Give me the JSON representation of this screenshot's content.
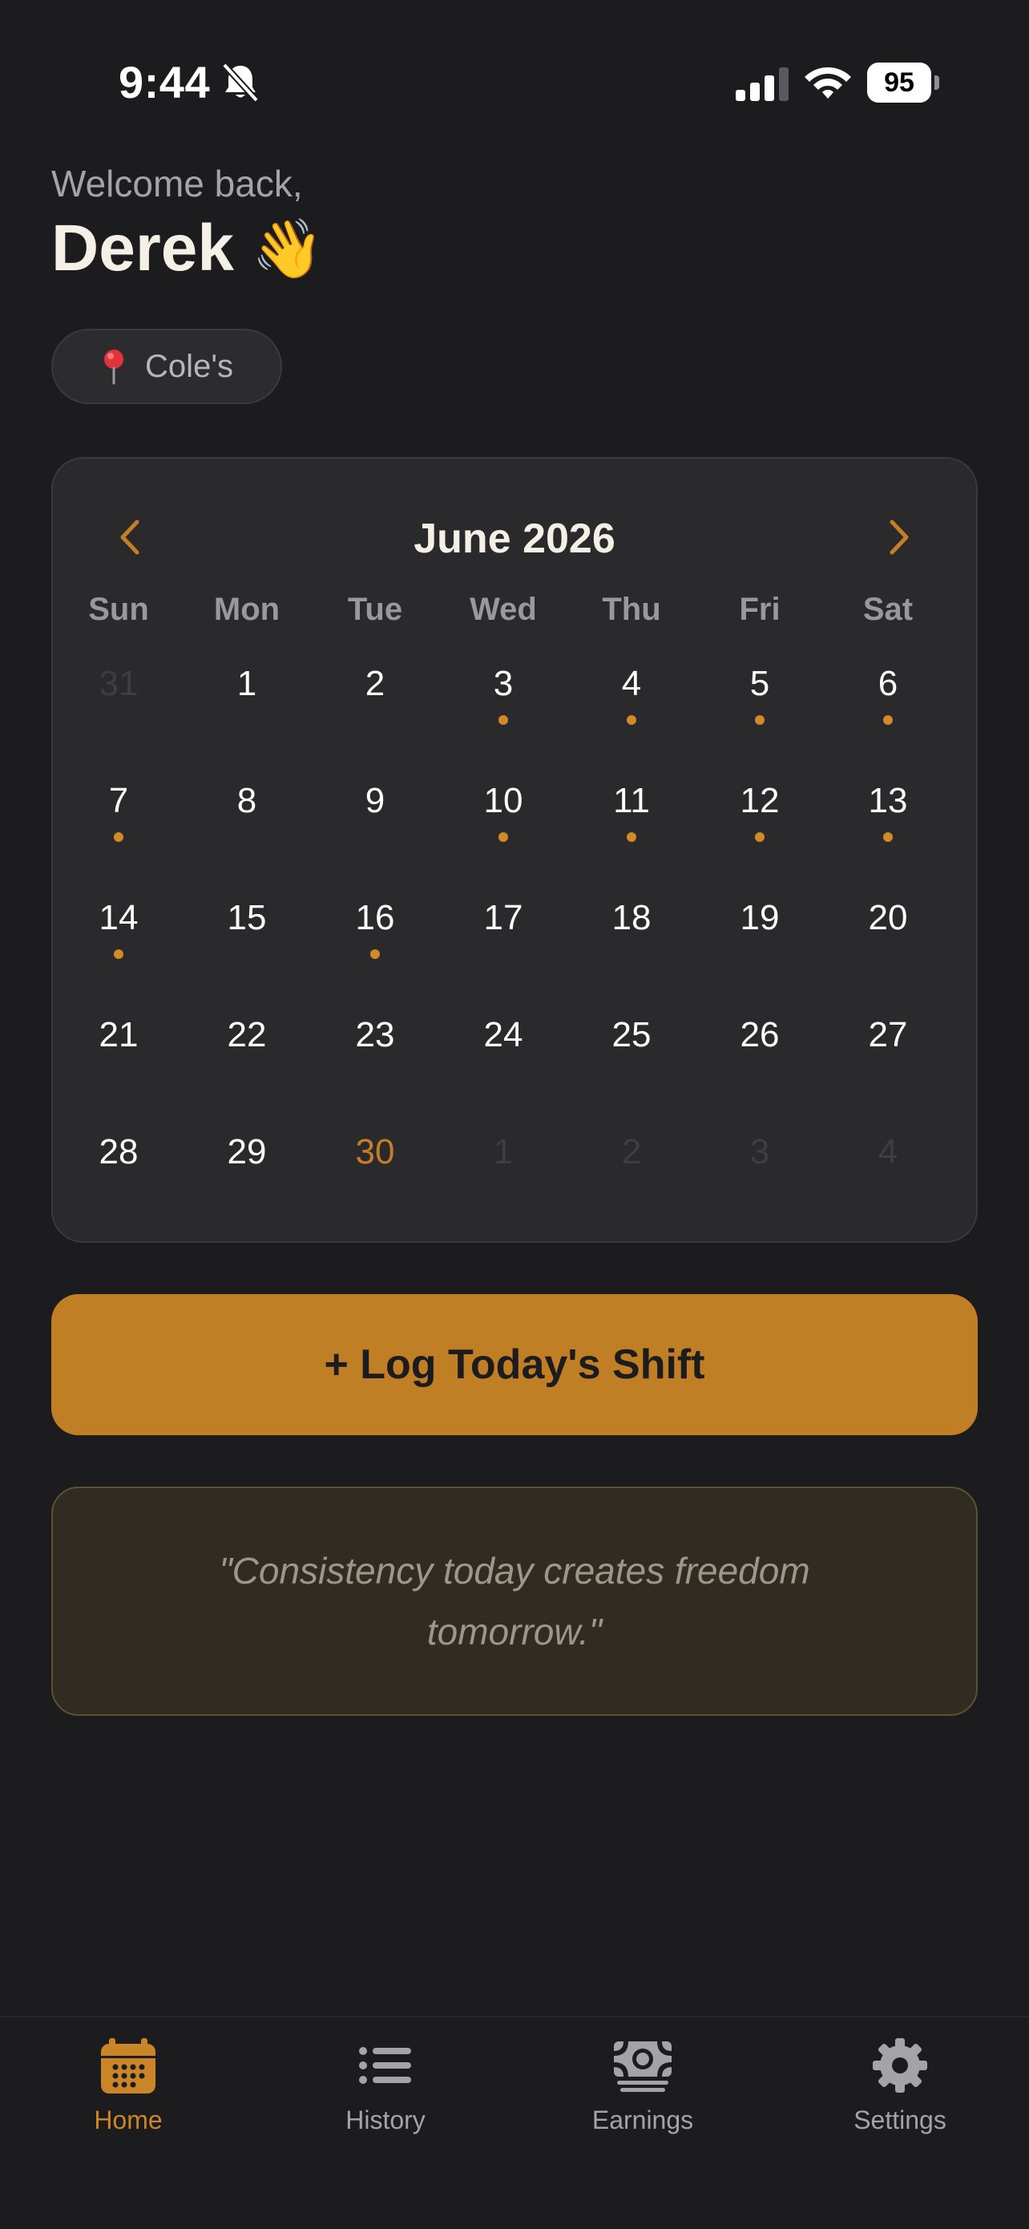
{
  "status_bar": {
    "time": "9:44",
    "battery": "95",
    "icons": [
      "bell-slash-icon",
      "cellular-signal-icon",
      "wifi-icon",
      "battery-icon"
    ]
  },
  "greeting": {
    "welcome": "Welcome back,",
    "name": "Derek",
    "emoji": "👋"
  },
  "location": {
    "icon": "pin-icon",
    "label": "Cole's"
  },
  "calendar": {
    "title": "June 2026",
    "prev_icon": "chevron-left-icon",
    "next_icon": "chevron-right-icon",
    "weekdays": [
      "Sun",
      "Mon",
      "Tue",
      "Wed",
      "Thu",
      "Fri",
      "Sat"
    ],
    "days": [
      {
        "label": "31",
        "in_month": false,
        "has_shift": false
      },
      {
        "label": "1",
        "in_month": true,
        "has_shift": false
      },
      {
        "label": "2",
        "in_month": true,
        "has_shift": false
      },
      {
        "label": "3",
        "in_month": true,
        "has_shift": true
      },
      {
        "label": "4",
        "in_month": true,
        "has_shift": true
      },
      {
        "label": "5",
        "in_month": true,
        "has_shift": true
      },
      {
        "label": "6",
        "in_month": true,
        "has_shift": true
      },
      {
        "label": "7",
        "in_month": true,
        "has_shift": true
      },
      {
        "label": "8",
        "in_month": true,
        "has_shift": false
      },
      {
        "label": "9",
        "in_month": true,
        "has_shift": false
      },
      {
        "label": "10",
        "in_month": true,
        "has_shift": true
      },
      {
        "label": "11",
        "in_month": true,
        "has_shift": true
      },
      {
        "label": "12",
        "in_month": true,
        "has_shift": true
      },
      {
        "label": "13",
        "in_month": true,
        "has_shift": true
      },
      {
        "label": "14",
        "in_month": true,
        "has_shift": true
      },
      {
        "label": "15",
        "in_month": true,
        "has_shift": false
      },
      {
        "label": "16",
        "in_month": true,
        "has_shift": true
      },
      {
        "label": "17",
        "in_month": true,
        "has_shift": false
      },
      {
        "label": "18",
        "in_month": true,
        "has_shift": false
      },
      {
        "label": "19",
        "in_month": true,
        "has_shift": false
      },
      {
        "label": "20",
        "in_month": true,
        "has_shift": false
      },
      {
        "label": "21",
        "in_month": true,
        "has_shift": false
      },
      {
        "label": "22",
        "in_month": true,
        "has_shift": false
      },
      {
        "label": "23",
        "in_month": true,
        "has_shift": false
      },
      {
        "label": "24",
        "in_month": true,
        "has_shift": false
      },
      {
        "label": "25",
        "in_month": true,
        "has_shift": false
      },
      {
        "label": "26",
        "in_month": true,
        "has_shift": false
      },
      {
        "label": "27",
        "in_month": true,
        "has_shift": false
      },
      {
        "label": "28",
        "in_month": true,
        "has_shift": false
      },
      {
        "label": "29",
        "in_month": true,
        "has_shift": false
      },
      {
        "label": "30",
        "in_month": true,
        "has_shift": false,
        "is_today": true
      },
      {
        "label": "1",
        "in_month": false,
        "has_shift": false
      },
      {
        "label": "2",
        "in_month": false,
        "has_shift": false
      },
      {
        "label": "3",
        "in_month": false,
        "has_shift": false
      },
      {
        "label": "4",
        "in_month": false,
        "has_shift": false
      }
    ]
  },
  "log_button": {
    "label": "+ Log Today's Shift"
  },
  "quote": {
    "text": "\"Consistency today creates freedom tomorrow.\""
  },
  "tab_bar": {
    "tabs": [
      {
        "label": "Home",
        "icon": "calendar-icon",
        "active": true
      },
      {
        "label": "History",
        "icon": "list-icon",
        "active": false
      },
      {
        "label": "Earnings",
        "icon": "money-icon",
        "active": false
      },
      {
        "label": "Settings",
        "icon": "gear-icon",
        "active": false
      }
    ]
  },
  "colors": {
    "background": "#1c1c1e",
    "card": "#2a2a2c",
    "accent": "#c17f25",
    "shift_dot": "#d08a28",
    "quote_bg": "#302c22"
  }
}
